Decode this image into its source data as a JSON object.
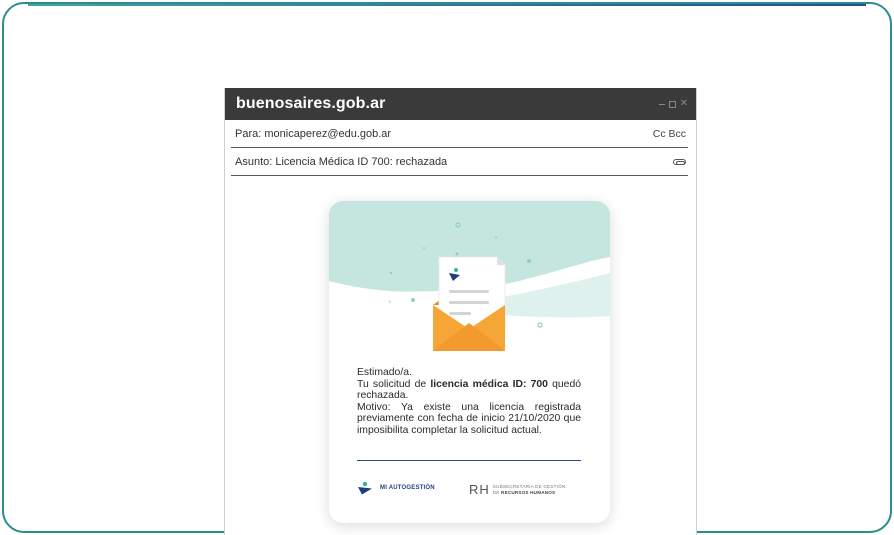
{
  "window": {
    "title": "buenosaires.gob.ar"
  },
  "email": {
    "to_label": "Para: monicaperez@edu.gob.ar",
    "cc_bcc": "Cc  Bcc",
    "subject_label": "Asunto: Licencia Médica ID 700: rechazada"
  },
  "message": {
    "greeting": "Estimado/a.",
    "line1_pre": "Tu solicitud de ",
    "line1_bold": "licencia médica ID: 700",
    "line1_post": " quedó rechazada.",
    "reason": "Motivo: Ya existe una licencia registrada previamente con fecha de inicio 21/10/2020 que imposibilita completar la solicitud actual."
  },
  "footer": {
    "mi_autogestion": "MI AUTOGESTIÓN",
    "rh_mark": "RH",
    "rh_line1": "SUBSECRETARÍA DE GESTIÓN",
    "rh_line2_pre": "DE ",
    "rh_line2_bold": "RECURSOS HUMANOS"
  },
  "colors": {
    "frame": "#2e8c8c",
    "titlebar": "#3a3a3a",
    "hero_bg": "#c5e6df",
    "envelope": "#f5a637",
    "brand_blue": "#1f3f7a",
    "brand_teal": "#3bb0a2"
  }
}
